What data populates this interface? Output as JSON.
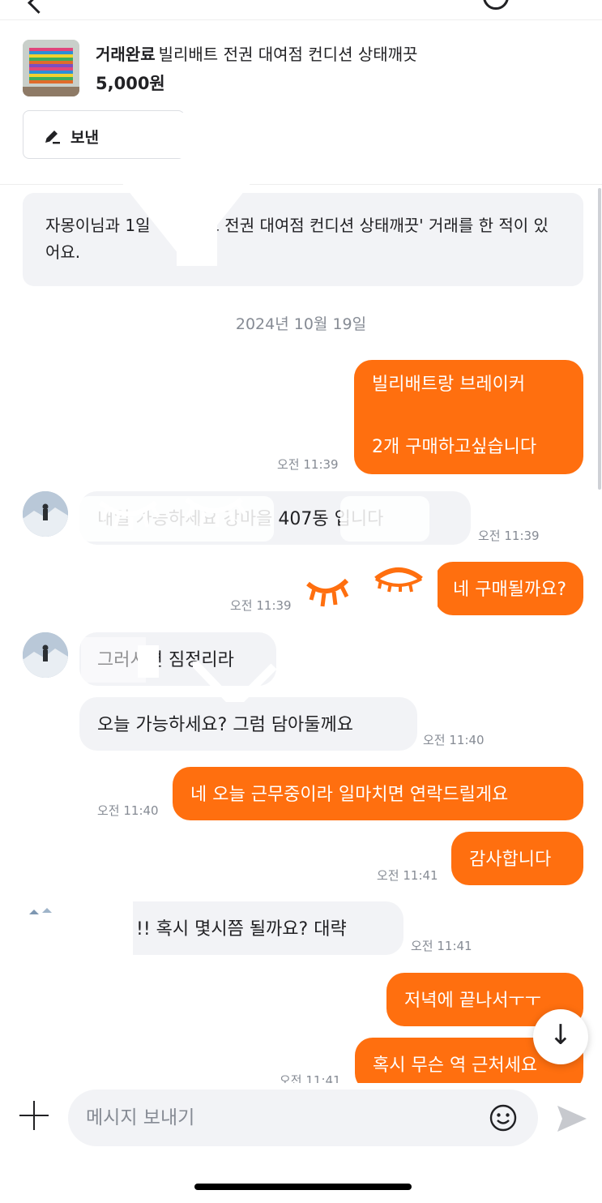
{
  "product": {
    "status": "거래완료",
    "title": "빌리배트 전권 대여점 컨디션 상태깨끗",
    "price": "5,000원",
    "review_button": "보낸"
  },
  "notice": {
    "text": "자몽이님과 1일 '빌리배트 전권 대여점 컨디션 상태깨끗' 거래를 한 적이 있어요."
  },
  "date_separator": "2024년 10월 19일",
  "messages": [
    {
      "line1": "빌리배트랑 브레이커",
      "line2": "2개 구매하고싶습니다",
      "time": "오전 11:39"
    },
    {
      "text": "내일 가능하세요 강마을 407동 입니다",
      "time": "오전 11:39"
    },
    {
      "text": "네 구매될까요?",
      "time": "오전 11:39"
    },
    {
      "text": "그러시면 짐정리라"
    },
    {
      "text": "오늘 가능하세요? 그럼 담아둘께요",
      "time": "오전 11:40"
    },
    {
      "text": "네 오늘 근무중이라 일마치면 연락드릴게요",
      "time": "오전 11:40"
    },
    {
      "text": "감사합니다",
      "time": "오전 11:41"
    },
    {
      "text": "!! 혹시 몇시쯤 될까요? 대략",
      "time": "오전 11:41"
    },
    {
      "text": "저녁에 끝나서ㅜㅜ"
    },
    {
      "text": "혹시 무슨 역 근처세요",
      "time": "오전 11:41"
    }
  ],
  "composer": {
    "placeholder": "메시지 보내기"
  },
  "colors": {
    "accent": "#ff6f0f",
    "bubble_in": "#f2f3f6",
    "muted_text": "#868b94"
  },
  "icons": [
    "back-icon",
    "more-icon",
    "pencil-icon",
    "arrow-down-icon",
    "plus-icon",
    "emoji-icon",
    "send-icon"
  ]
}
